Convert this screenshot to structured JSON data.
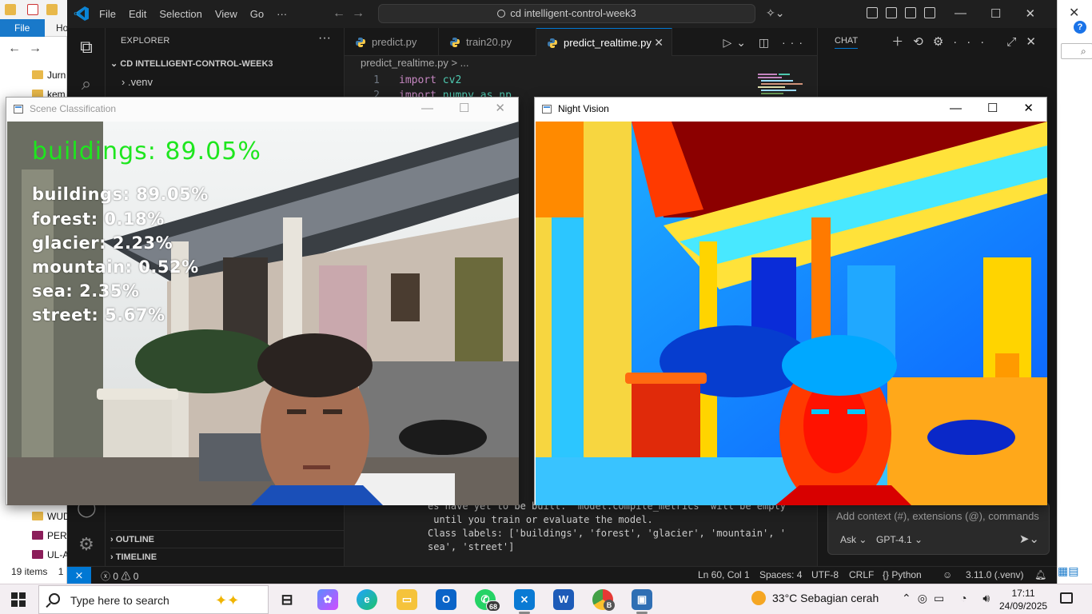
{
  "file_explorer": {
    "file_tab": "File",
    "home_tab": "Ho",
    "items": [
      "Jurn",
      "kem",
      "WUD",
      "PERA",
      "UL-A"
    ],
    "status": "19 items",
    "status_extra": "1"
  },
  "vscode": {
    "menu": [
      "File",
      "Edit",
      "Selection",
      "View",
      "Go"
    ],
    "menu_more": "···",
    "command_center": "cd intelligent-control-week3",
    "explorer": {
      "title": "EXPLORER",
      "project": "CD INTELLIGENT-CONTROL-WEEK3",
      "items": [
        ".venv"
      ],
      "sections": [
        "OUTLINE",
        "TIMELINE"
      ]
    },
    "tabs": [
      {
        "label": "predict.py",
        "active": false
      },
      {
        "label": "train20.py",
        "active": false
      },
      {
        "label": "predict_realtime.py",
        "active": true
      }
    ],
    "breadcrumb": "predict_realtime.py > ...",
    "code": [
      {
        "line": "1",
        "kw": "import",
        "mod": "cv2"
      },
      {
        "line": "2",
        "kw": "import",
        "mod": "numpy as np"
      }
    ],
    "terminal": [
      "es have yet to be built. `model.compile_metrics` will be empty",
      " until you train or evaluate the model.",
      "Class labels: ['buildings', 'forest', 'glacier', 'mountain', '",
      "sea', 'street']"
    ],
    "chat": {
      "title": "CHAT",
      "placeholder": "Add context (#), extensions (@), commands",
      "mode": "Ask",
      "model": "GPT-4.1"
    },
    "statusbar": {
      "problems": "0",
      "warnings": "0",
      "position": "Ln 60, Col 1",
      "spaces": "Spaces: 4",
      "encoding": "UTF-8",
      "eol": "CRLF",
      "language": "Python",
      "interpreter": "3.11.0 (.venv)"
    }
  },
  "scene_window": {
    "title": "Scene Classification",
    "top_prediction": "buildings: 89.05%",
    "scores": [
      "buildings: 89.05%",
      "forest: 0.18%",
      "glacier: 2.23%",
      "mountain: 0.52%",
      "sea: 2.35%",
      "street: 5.67%"
    ]
  },
  "night_window": {
    "title": "Night Vision"
  },
  "taskbar": {
    "search_placeholder": "Type here to search",
    "whatsapp_badge": "68",
    "chrome_profile": "B",
    "weather": "33°C  Sebagian cerah",
    "time": "17:11",
    "date": "24/09/2025"
  },
  "colors": {
    "vscode_bg": "#1f1f1f",
    "accent": "#0078d4",
    "overlay_main": "#1ee61e",
    "overlay_text": "#ffffff"
  }
}
